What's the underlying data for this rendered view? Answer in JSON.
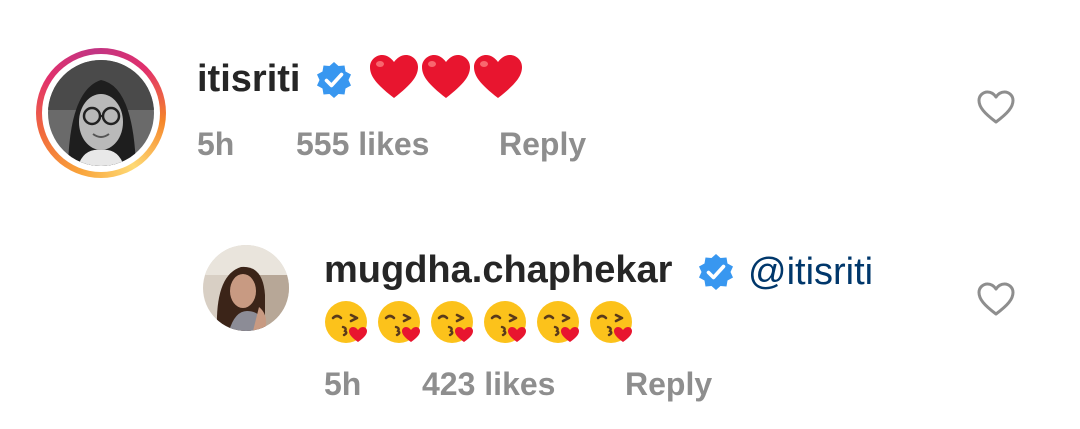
{
  "comments": [
    {
      "username": "itisriti",
      "verified": true,
      "text": "❤️❤️❤️",
      "time": "5h",
      "likes": "555 likes",
      "reply_label": "Reply",
      "avatar_icon": "profile-photo",
      "like_icon": "heart-outline-icon"
    },
    {
      "username": "mugdha.chaphekar",
      "verified": true,
      "mention": "@itisriti",
      "emoji_count": 6,
      "emoji_name": "face-blowing-kiss",
      "time": "5h",
      "likes": "423 likes",
      "reply_label": "Reply",
      "avatar_icon": "profile-photo",
      "like_icon": "heart-outline-icon"
    }
  ],
  "colors": {
    "username": "#262626",
    "meta": "#8e8e8e",
    "mention": "#00376b",
    "verified": "#3897f0",
    "heart_red": "#e8152f",
    "ring_start": "#f58529",
    "ring_mid": "#dd2a7b"
  }
}
